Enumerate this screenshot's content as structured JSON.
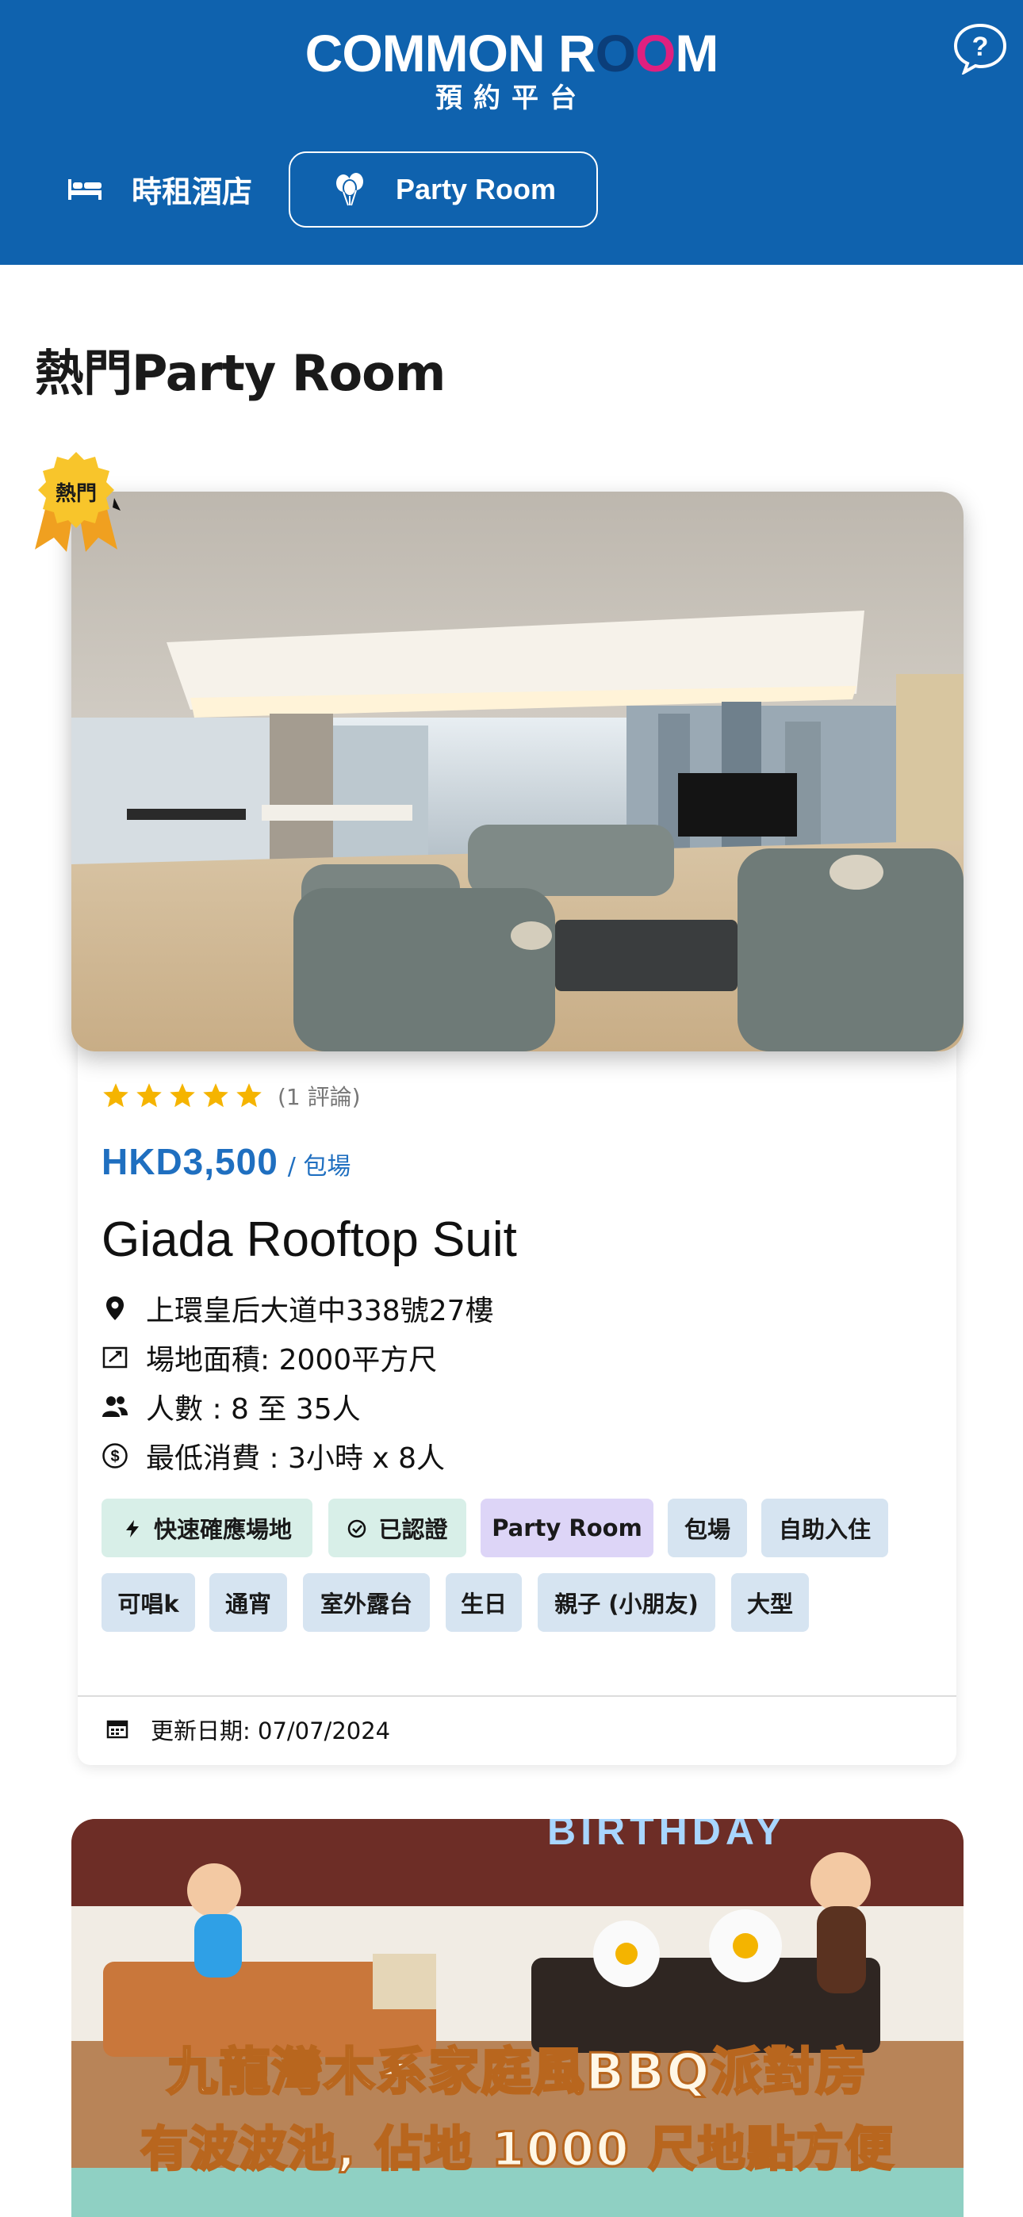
{
  "header": {
    "logo_common": "COMMON R",
    "logo_o1": "O",
    "logo_o2": "O",
    "logo_m": "M",
    "logo_sub": "預約平台",
    "help_icon": "help-bubble-icon",
    "tabs": [
      {
        "label": "時租酒店",
        "icon": "bed-icon"
      },
      {
        "label": "Party Room",
        "icon": "balloons-icon",
        "active": true
      }
    ]
  },
  "section_title": "熱門Party Room",
  "listing": {
    "badge": "熱門",
    "rating_stars": 5,
    "reviews": "(1 評論)",
    "price": "HKD3,500",
    "price_unit": "/ 包場",
    "name": "Giada Rooftop Suit",
    "address": "上環皇后大道中338號27樓",
    "area": "場地面積: 2000平方尺",
    "capacity": "人數 : 8 至 35人",
    "min_spend": "最低消費 : 3小時 x 8人",
    "tags": [
      {
        "label": "快速確應場地",
        "style": "green",
        "icon": "bolt-icon"
      },
      {
        "label": "已認證",
        "style": "green",
        "icon": "verified-icon"
      },
      {
        "label": "Party Room",
        "style": "purple"
      },
      {
        "label": "包場",
        "style": "blue"
      },
      {
        "label": "自助入住",
        "style": "blue"
      },
      {
        "label": "可唱k",
        "style": "blue"
      },
      {
        "label": "通宵",
        "style": "blue"
      },
      {
        "label": "室外露台",
        "style": "blue"
      },
      {
        "label": "生日",
        "style": "blue"
      },
      {
        "label": "親子 (小朋友)",
        "style": "blue"
      },
      {
        "label": "大型",
        "style": "blue"
      }
    ],
    "updated": "更新日期: 07/07/2024"
  },
  "listing2": {
    "banner_line1": "九龍灣木系家庭風BBQ派對房",
    "banner_line2": "有波波池, 佔地 1000 尺地點方便",
    "sign": "BIRTHDAY"
  },
  "colors": {
    "header_bg": "#0f62ae",
    "price": "#1f6fc0",
    "star": "#f5b400",
    "accent_pink": "#e0207f"
  }
}
